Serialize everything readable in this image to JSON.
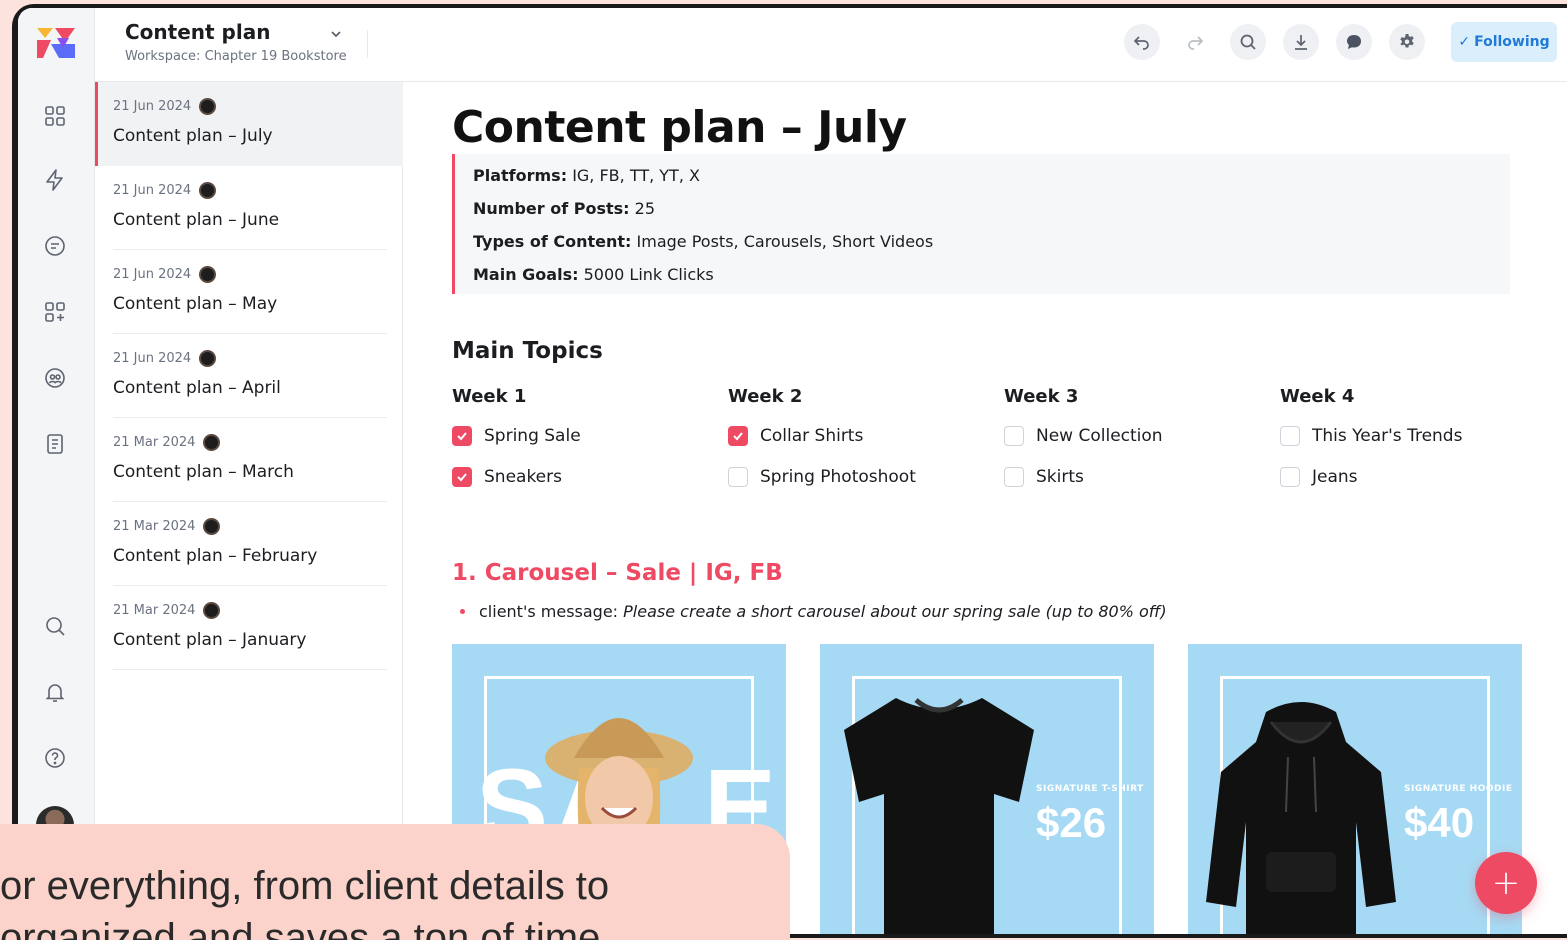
{
  "app": {
    "doc_title": "Content plan",
    "workspace": "Workspace: Chapter 19 Bookstore",
    "following_label": "Following",
    "brand_color": "#ee4a63",
    "rail_icons": [
      "dashboard-icon",
      "bolt-icon",
      "chat-icon",
      "apps-icon",
      "team-icon",
      "document-icon",
      "search-icon",
      "bell-icon",
      "help-icon"
    ],
    "toolbar_icons": [
      "undo-icon",
      "redo-icon",
      "search-icon",
      "download-icon",
      "comment-icon",
      "settings-icon"
    ]
  },
  "doclist": [
    {
      "date": "21 Jun 2024",
      "name": "Content plan – July",
      "active": true
    },
    {
      "date": "21 Jun 2024",
      "name": "Content plan – June"
    },
    {
      "date": "21 Jun 2024",
      "name": "Content plan – May"
    },
    {
      "date": "21 Jun 2024",
      "name": "Content plan – April"
    },
    {
      "date": "21 Mar 2024",
      "name": "Content plan – March"
    },
    {
      "date": "21 Mar 2024",
      "name": "Content plan – February"
    },
    {
      "date": "21 Mar 2024",
      "name": "Content plan – January"
    }
  ],
  "page": {
    "title": "Content plan – July",
    "info": [
      {
        "label": "Platforms:",
        "value": "IG, FB, TT, YT, X"
      },
      {
        "label": "Number of Posts:",
        "value": "25"
      },
      {
        "label": "Types of Content:",
        "value": "Image Posts, Carousels, Short Videos"
      },
      {
        "label": "Main Goals:",
        "value": "5000 Link Clicks"
      }
    ],
    "main_topics_heading": "Main Topics",
    "weeks": [
      {
        "title": "Week 1",
        "items": [
          {
            "label": "Spring Sale",
            "checked": true
          },
          {
            "label": "Sneakers",
            "checked": true
          }
        ]
      },
      {
        "title": "Week 2",
        "items": [
          {
            "label": "Collar Shirts",
            "checked": true
          },
          {
            "label": "Spring Photoshoot",
            "checked": false
          }
        ]
      },
      {
        "title": "Week 3",
        "items": [
          {
            "label": "New Collection",
            "checked": false
          },
          {
            "label": "Skirts",
            "checked": false
          }
        ]
      },
      {
        "title": "Week 4",
        "items": [
          {
            "label": "This Year's Trends",
            "checked": false
          },
          {
            "label": "Jeans",
            "checked": false
          }
        ]
      }
    ],
    "post_heading": "1. Carousel – Sale | IG, FB",
    "bullet_label": "client's message:",
    "bullet_text": "Please create a short carousel about our spring sale (up to 80% off)",
    "cards": [
      {
        "kind": "sale",
        "word": "SALE"
      },
      {
        "kind": "tshirt",
        "label": "SIGNATURE T-SHIRT",
        "price": "$26"
      },
      {
        "kind": "hoodie",
        "label": "SIGNATURE HOODIE",
        "price": "$40"
      }
    ]
  },
  "caption": {
    "line1": "or everything, from client details to",
    "line2": "organized and saves a ton of time."
  }
}
